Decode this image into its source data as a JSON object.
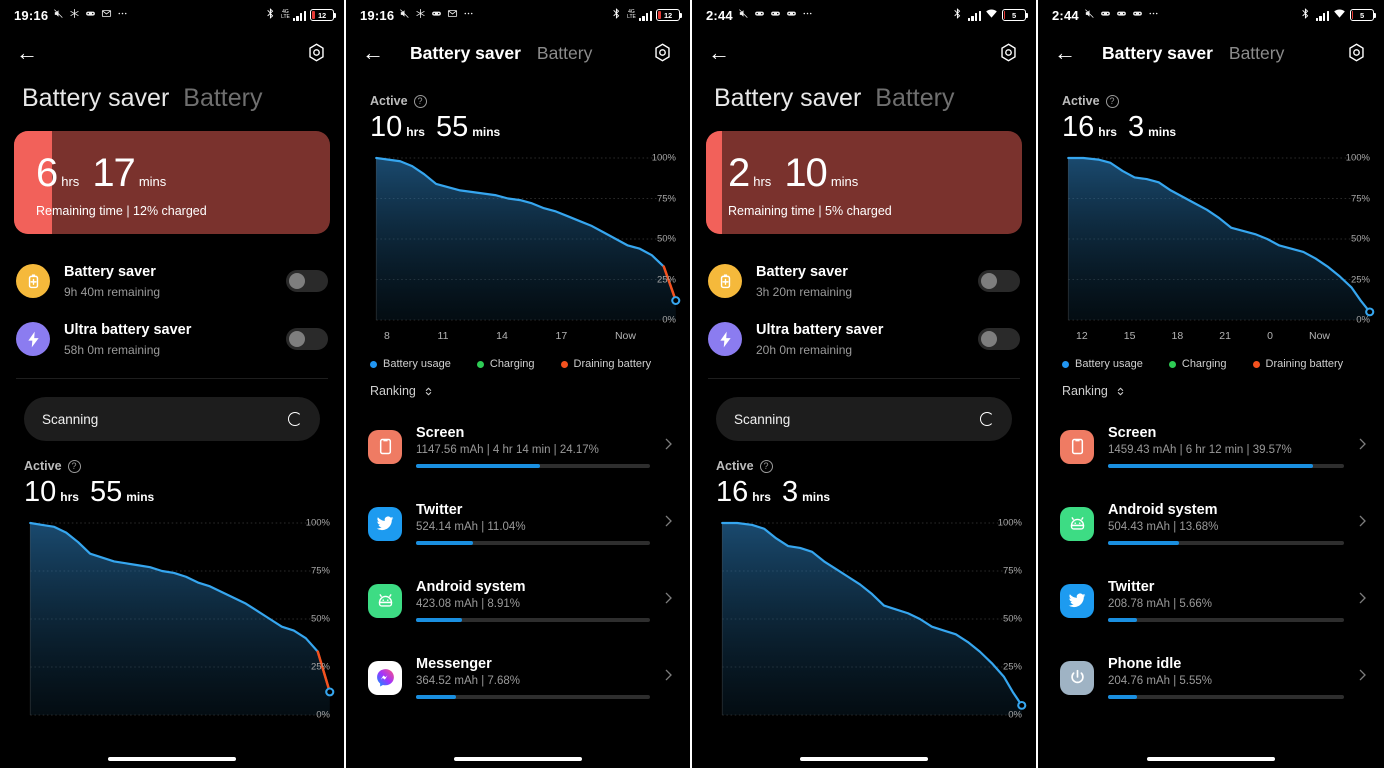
{
  "theme": {
    "accent_blue": "#1a8fe0",
    "line_blue": "#36a6ef",
    "card_red_strip": "#f2615a",
    "card_red_bg": "#7a322d",
    "charging_green": "#2ecc55",
    "draining_orange": "#f4511e",
    "battery_red": "#e53935"
  },
  "panels": [
    {
      "id": "panel-1",
      "status": {
        "time": "19:16",
        "left_icons": [
          "mute-icon",
          "snowflake-icon",
          "game-icon",
          "mail-icon",
          "more-icon"
        ],
        "right_icons": [
          "bluetooth-icon",
          "signal-icon"
        ],
        "wifi": false,
        "battery_percent": "12",
        "battery_color": "#e53935"
      },
      "appbar": {
        "back": "←",
        "title": "",
        "alt": "",
        "gear": "settings-icon",
        "compact": false
      },
      "bigtabs": {
        "active": "Battery saver",
        "inactive": "Battery"
      },
      "remaining_card": {
        "hours": "6",
        "hrs_label": "hrs",
        "mins": "17",
        "mins_label": "mins",
        "subtitle": "Remaining time | 12% charged",
        "charge_percent": 12
      },
      "savers": [
        {
          "icon": "battery-plus-icon",
          "icon_bg": "#f5b93b",
          "title": "Battery saver",
          "subtitle": "9h 40m remaining",
          "enabled": false
        },
        {
          "icon": "bolt-icon",
          "icon_bg": "#8b7cf0",
          "title": "Ultra battery saver",
          "subtitle": "58h 0m remaining",
          "enabled": false
        }
      ],
      "scanning": {
        "label": "Scanning",
        "icon": "spinner-icon"
      },
      "active": {
        "label": "Active",
        "help": "?",
        "hours": "10",
        "hrs_label": "hrs",
        "mins": "55",
        "mins_label": "mins"
      },
      "show_chart": true,
      "chart_ref": 0,
      "show_ranking": false,
      "home_indicator": true
    },
    {
      "id": "panel-2",
      "status": {
        "time": "19:16",
        "left_icons": [
          "mute-icon",
          "snowflake-icon",
          "game-icon",
          "mail-icon",
          "more-icon"
        ],
        "right_icons": [
          "bluetooth-icon",
          "signal-icon"
        ],
        "wifi": false,
        "battery_percent": "12",
        "battery_color": "#e53935"
      },
      "appbar": {
        "back": "←",
        "title": "Battery saver",
        "alt": "Battery",
        "gear": "settings-icon",
        "compact": true
      },
      "bigtabs": null,
      "remaining_card": null,
      "savers": [],
      "scanning": null,
      "active": {
        "label": "Active",
        "help": "?",
        "hours": "10",
        "hrs_label": "hrs",
        "mins": "55",
        "mins_label": "mins"
      },
      "show_chart": true,
      "chart_ref": 1,
      "show_ranking": true,
      "ranking": {
        "title": "Ranking",
        "sort_icon": "sort-arrows-icon",
        "items": [
          {
            "icon": "screen-icon",
            "icon_bg": "#ef7b63",
            "name": "Screen",
            "meta": "1147.56 mAh | 4 hr 14 min  | 24.17%",
            "percent": 24.17
          },
          {
            "icon": "twitter-icon",
            "icon_bg": "#1d9bf0",
            "name": "Twitter",
            "meta": "524.14 mAh | 11.04%",
            "percent": 11.04
          },
          {
            "icon": "android-icon",
            "icon_bg": "#3ddc84",
            "name": "Android system",
            "meta": "423.08 mAh | 8.91%",
            "percent": 8.91
          },
          {
            "icon": "messenger-icon",
            "icon_bg": "#ffffff",
            "name": "Messenger",
            "meta": "364.52 mAh | 7.68%",
            "percent": 7.68
          }
        ]
      },
      "home_indicator": true
    },
    {
      "id": "panel-3",
      "status": {
        "time": "2:44",
        "left_icons": [
          "mute-icon",
          "game-icon",
          "game-icon",
          "game-icon",
          "more-icon"
        ],
        "right_icons": [
          "bluetooth-icon",
          "signal-icon"
        ],
        "wifi": true,
        "battery_percent": "5",
        "battery_color": "#e53935"
      },
      "appbar": {
        "back": "←",
        "title": "",
        "alt": "",
        "gear": "settings-icon",
        "compact": false
      },
      "bigtabs": {
        "active": "Battery saver",
        "inactive": "Battery"
      },
      "remaining_card": {
        "hours": "2",
        "hrs_label": "hrs",
        "mins": "10",
        "mins_label": "mins",
        "subtitle": "Remaining time | 5% charged",
        "charge_percent": 5
      },
      "savers": [
        {
          "icon": "battery-plus-icon",
          "icon_bg": "#f5b93b",
          "title": "Battery saver",
          "subtitle": "3h 20m remaining",
          "enabled": false
        },
        {
          "icon": "bolt-icon",
          "icon_bg": "#8b7cf0",
          "title": "Ultra battery saver",
          "subtitle": "20h 0m remaining",
          "enabled": false
        }
      ],
      "scanning": {
        "label": "Scanning",
        "icon": "spinner-icon"
      },
      "active": {
        "label": "Active",
        "help": "?",
        "hours": "16",
        "hrs_label": "hrs",
        "mins": "3",
        "mins_label": "mins"
      },
      "show_chart": true,
      "chart_ref": 2,
      "show_ranking": false,
      "home_indicator": true
    },
    {
      "id": "panel-4",
      "status": {
        "time": "2:44",
        "left_icons": [
          "mute-icon",
          "game-icon",
          "game-icon",
          "game-icon",
          "more-icon"
        ],
        "right_icons": [
          "bluetooth-icon",
          "signal-icon"
        ],
        "wifi": true,
        "battery_percent": "5",
        "battery_color": "#e53935"
      },
      "appbar": {
        "back": "←",
        "title": "Battery saver",
        "alt": "Battery",
        "gear": "settings-icon",
        "compact": true
      },
      "bigtabs": null,
      "remaining_card": null,
      "savers": [],
      "scanning": null,
      "active": {
        "label": "Active",
        "help": "?",
        "hours": "16",
        "hrs_label": "hrs",
        "mins": "3",
        "mins_label": "mins"
      },
      "show_chart": true,
      "chart_ref": 3,
      "show_ranking": true,
      "ranking": {
        "title": "Ranking",
        "sort_icon": "sort-arrows-icon",
        "items": [
          {
            "icon": "screen-icon",
            "icon_bg": "#ef7b63",
            "name": "Screen",
            "meta": "1459.43 mAh | 6 hr 12 min  | 39.57%",
            "percent": 39.57
          },
          {
            "icon": "android-icon",
            "icon_bg": "#3ddc84",
            "name": "Android system",
            "meta": "504.43 mAh | 13.68%",
            "percent": 13.68
          },
          {
            "icon": "twitter-icon",
            "icon_bg": "#1d9bf0",
            "name": "Twitter",
            "meta": "208.78 mAh | 5.66%",
            "percent": 5.66
          },
          {
            "icon": "power-icon",
            "icon_bg": "#9fb3c4",
            "name": "Phone idle",
            "meta": "204.76 mAh | 5.55%",
            "percent": 5.55
          }
        ]
      },
      "home_indicator": true
    }
  ],
  "chart_data": [
    {
      "type": "area",
      "title": "Battery usage",
      "xlabel": "",
      "ylabel": "%",
      "ylim": [
        0,
        100
      ],
      "yticks": [
        0,
        25,
        50,
        75,
        100
      ],
      "ytick_labels": [
        "0%",
        "25%",
        "50%",
        "75%",
        "100%"
      ],
      "grid": true,
      "xtick_labels": [
        "8",
        "11",
        "14",
        "17",
        "Now"
      ],
      "legend": [
        {
          "label": "Battery usage",
          "color": "#2196f3"
        },
        {
          "label": "Charging",
          "color": "#2ecc55"
        },
        {
          "label": "Draining battery",
          "color": "#f4511e"
        }
      ],
      "legend_position": "below",
      "x": [
        0,
        4,
        8,
        12,
        16,
        20,
        24,
        28,
        32,
        36,
        40,
        44,
        48,
        52,
        56,
        60,
        64,
        68,
        72,
        76,
        80,
        84,
        88,
        92,
        96,
        100
      ],
      "values": [
        100,
        99,
        98,
        95,
        90,
        84,
        82,
        80,
        79,
        78,
        77,
        75,
        74,
        72,
        69,
        67,
        64,
        61,
        58,
        54,
        50,
        46,
        44,
        40,
        33,
        12
      ],
      "marker_value": 12,
      "tail_color": "#f4511e"
    },
    {
      "type": "area",
      "title": "Battery usage",
      "xlabel": "",
      "ylabel": "%",
      "ylim": [
        0,
        100
      ],
      "yticks": [
        0,
        25,
        50,
        75,
        100
      ],
      "ytick_labels": [
        "0%",
        "25%",
        "50%",
        "75%",
        "100%"
      ],
      "grid": true,
      "xtick_labels": [
        "8",
        "11",
        "14",
        "17",
        "Now"
      ],
      "legend": [
        {
          "label": "Battery usage",
          "color": "#2196f3"
        },
        {
          "label": "Charging",
          "color": "#2ecc55"
        },
        {
          "label": "Draining battery",
          "color": "#f4511e"
        }
      ],
      "legend_position": "below",
      "x": [
        0,
        4,
        8,
        12,
        16,
        20,
        24,
        28,
        32,
        36,
        40,
        44,
        48,
        52,
        56,
        60,
        64,
        68,
        72,
        76,
        80,
        84,
        88,
        92,
        96,
        100
      ],
      "values": [
        100,
        99,
        98,
        95,
        90,
        84,
        82,
        80,
        79,
        78,
        77,
        75,
        74,
        72,
        69,
        67,
        64,
        61,
        58,
        54,
        50,
        46,
        44,
        40,
        33,
        12
      ],
      "marker_value": 12,
      "tail_color": "#f4511e"
    },
    {
      "type": "area",
      "title": "Battery usage",
      "xlabel": "",
      "ylabel": "%",
      "ylim": [
        0,
        100
      ],
      "yticks": [
        0,
        25,
        50,
        75,
        100
      ],
      "ytick_labels": [
        "0%",
        "25%",
        "50%",
        "75%",
        "100%"
      ],
      "grid": true,
      "xtick_labels": [
        "12",
        "15",
        "18",
        "21",
        "0",
        "Now"
      ],
      "legend": [
        {
          "label": "Battery usage",
          "color": "#2196f3"
        },
        {
          "label": "Charging",
          "color": "#2ecc55"
        },
        {
          "label": "Draining battery",
          "color": "#f4511e"
        }
      ],
      "legend_position": "below",
      "x": [
        0,
        5,
        10,
        14,
        18,
        22,
        26,
        30,
        34,
        38,
        42,
        46,
        50,
        54,
        58,
        62,
        66,
        70,
        74,
        78,
        82,
        86,
        90,
        94,
        97,
        100
      ],
      "values": [
        100,
        100,
        99,
        97,
        92,
        88,
        87,
        85,
        80,
        76,
        72,
        68,
        63,
        57,
        55,
        53,
        50,
        46,
        44,
        42,
        38,
        33,
        27,
        20,
        12,
        5
      ],
      "marker_value": 5,
      "tail_color": "#36a6ef"
    },
    {
      "type": "area",
      "title": "Battery usage",
      "xlabel": "",
      "ylabel": "%",
      "ylim": [
        0,
        100
      ],
      "yticks": [
        0,
        25,
        50,
        75,
        100
      ],
      "ytick_labels": [
        "0%",
        "25%",
        "50%",
        "75%",
        "100%"
      ],
      "grid": true,
      "xtick_labels": [
        "12",
        "15",
        "18",
        "21",
        "0",
        "Now"
      ],
      "legend": [
        {
          "label": "Battery usage",
          "color": "#2196f3"
        },
        {
          "label": "Charging",
          "color": "#2ecc55"
        },
        {
          "label": "Draining battery",
          "color": "#f4511e"
        }
      ],
      "legend_position": "below",
      "x": [
        0,
        5,
        10,
        14,
        18,
        22,
        26,
        30,
        34,
        38,
        42,
        46,
        50,
        54,
        58,
        62,
        66,
        70,
        74,
        78,
        82,
        86,
        90,
        94,
        97,
        100
      ],
      "values": [
        100,
        100,
        99,
        97,
        92,
        88,
        87,
        85,
        80,
        76,
        72,
        68,
        63,
        57,
        55,
        53,
        50,
        46,
        44,
        42,
        38,
        33,
        27,
        20,
        12,
        5
      ],
      "marker_value": 5,
      "tail_color": "#36a6ef"
    }
  ]
}
